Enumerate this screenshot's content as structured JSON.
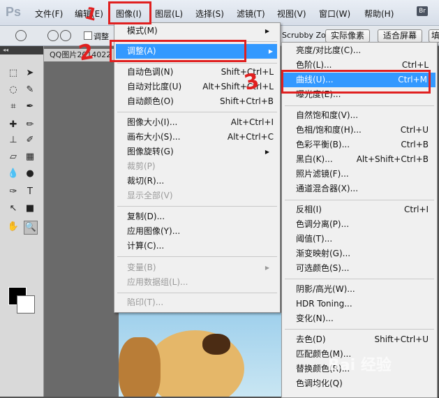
{
  "menubar": {
    "logo": "Ps",
    "items": [
      "文件(F)",
      "编辑(E)",
      "图像(I)",
      "图层(L)",
      "选择(S)",
      "滤镜(T)",
      "视图(V)",
      "窗口(W)",
      "帮助(H)"
    ],
    "bridge": "Br"
  },
  "options": {
    "resize_checkbox": "调整",
    "scrubby_zoom": "Scrubby Zoom",
    "actual_pixels": "实际像素",
    "fit_screen": "适合屏幕",
    "fill_screen": "填"
  },
  "document": {
    "tab": "QQ图片2014022"
  },
  "image_menu": {
    "items": [
      {
        "label": "模式(M)",
        "shortcut": "",
        "submenu": true
      },
      {
        "label": "调整(A)",
        "shortcut": "",
        "submenu": true,
        "highlight": true
      },
      {
        "label": "自动色调(N)",
        "shortcut": "Shift+Ctrl+L"
      },
      {
        "label": "自动对比度(U)",
        "shortcut": "Alt+Shift+Ctrl+L"
      },
      {
        "label": "自动颜色(O)",
        "shortcut": "Shift+Ctrl+B"
      },
      {
        "label": "图像大小(I)...",
        "shortcut": "Alt+Ctrl+I"
      },
      {
        "label": "画布大小(S)...",
        "shortcut": "Alt+Ctrl+C"
      },
      {
        "label": "图像旋转(G)",
        "shortcut": "",
        "submenu": true
      },
      {
        "label": "裁剪(P)",
        "shortcut": "",
        "disabled": true
      },
      {
        "label": "裁切(R)...",
        "shortcut": ""
      },
      {
        "label": "显示全部(V)",
        "shortcut": "",
        "disabled": true
      },
      {
        "label": "复制(D)...",
        "shortcut": ""
      },
      {
        "label": "应用图像(Y)...",
        "shortcut": ""
      },
      {
        "label": "计算(C)...",
        "shortcut": ""
      },
      {
        "label": "变量(B)",
        "shortcut": "",
        "submenu": true,
        "disabled": true
      },
      {
        "label": "应用数据组(L)...",
        "shortcut": "",
        "disabled": true
      },
      {
        "label": "陷印(T)...",
        "shortcut": "",
        "disabled": true
      }
    ]
  },
  "adjust_menu": {
    "items": [
      {
        "label": "亮度/对比度(C)...",
        "shortcut": ""
      },
      {
        "label": "色阶(L)...",
        "shortcut": "Ctrl+L"
      },
      {
        "label": "曲线(U)...",
        "shortcut": "Ctrl+M",
        "highlight": true
      },
      {
        "label": "曝光度(E)...",
        "shortcut": ""
      },
      {
        "label": "自然饱和度(V)...",
        "shortcut": ""
      },
      {
        "label": "色相/饱和度(H)...",
        "shortcut": "Ctrl+U"
      },
      {
        "label": "色彩平衡(B)...",
        "shortcut": "Ctrl+B"
      },
      {
        "label": "黑白(K)...",
        "shortcut": "Alt+Shift+Ctrl+B"
      },
      {
        "label": "照片滤镜(F)...",
        "shortcut": ""
      },
      {
        "label": "通道混合器(X)...",
        "shortcut": ""
      },
      {
        "label": "反相(I)",
        "shortcut": "Ctrl+I"
      },
      {
        "label": "色调分离(P)...",
        "shortcut": ""
      },
      {
        "label": "阈值(T)...",
        "shortcut": ""
      },
      {
        "label": "渐变映射(G)...",
        "shortcut": ""
      },
      {
        "label": "可选颜色(S)...",
        "shortcut": ""
      },
      {
        "label": "阴影/高光(W)...",
        "shortcut": ""
      },
      {
        "label": "HDR Toning...",
        "shortcut": ""
      },
      {
        "label": "变化(N)...",
        "shortcut": ""
      },
      {
        "label": "去色(D)",
        "shortcut": "Shift+Ctrl+U"
      },
      {
        "label": "匹配颜色(M)...",
        "shortcut": ""
      },
      {
        "label": "替换颜色(R)...",
        "shortcut": ""
      },
      {
        "label": "色调均化(Q)",
        "shortcut": ""
      }
    ]
  },
  "annotations": {
    "step1": "1",
    "step2": "2",
    "step3": "3"
  },
  "watermark": "Bai 经验",
  "colors": {
    "accent": "#3399ff",
    "annotation": "#e02020"
  }
}
